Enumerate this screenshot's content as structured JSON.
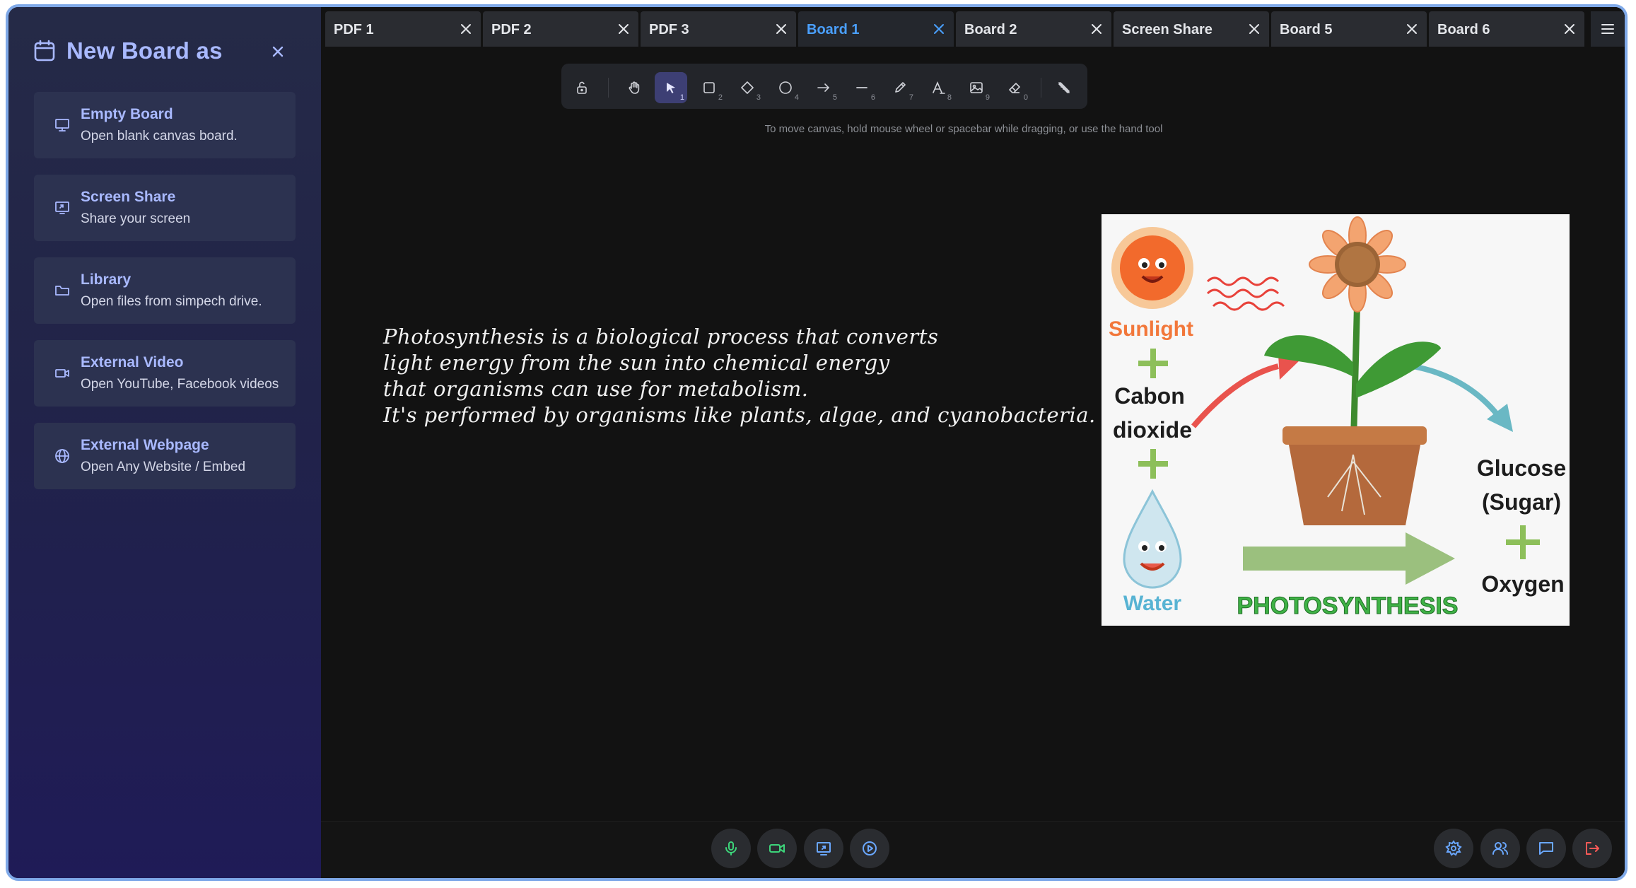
{
  "sidebar": {
    "title": "New Board as",
    "items": [
      {
        "title": "Empty Board",
        "subtitle": "Open blank canvas board.",
        "icon": "presentation-board-icon"
      },
      {
        "title": "Screen Share",
        "subtitle": "Share your screen",
        "icon": "screen-share-icon"
      },
      {
        "title": "Library",
        "subtitle": "Open files from simpech drive.",
        "icon": "folder-icon"
      },
      {
        "title": "External Video",
        "subtitle": "Open YouTube, Facebook videos",
        "icon": "video-camera-icon"
      },
      {
        "title": "External Webpage",
        "subtitle": "Open Any Website / Embed",
        "icon": "globe-icon"
      }
    ]
  },
  "tabs": [
    {
      "label": "PDF 1",
      "active": false
    },
    {
      "label": "PDF 2",
      "active": false
    },
    {
      "label": "PDF 3",
      "active": false
    },
    {
      "label": "Board 1",
      "active": true
    },
    {
      "label": "Board 2",
      "active": false
    },
    {
      "label": "Screen Share",
      "active": false
    },
    {
      "label": "Board 5",
      "active": false
    },
    {
      "label": "Board 6",
      "active": false
    }
  ],
  "toolbar": {
    "tools": [
      {
        "name": "lock-icon",
        "key": ""
      },
      {
        "name": "hand-icon",
        "key": ""
      },
      {
        "name": "select-arrow-icon",
        "key": "1",
        "selected": true
      },
      {
        "name": "rectangle-icon",
        "key": "2"
      },
      {
        "name": "diamond-icon",
        "key": "3"
      },
      {
        "name": "ellipse-icon",
        "key": "4"
      },
      {
        "name": "arrow-icon",
        "key": "5"
      },
      {
        "name": "line-icon",
        "key": "6"
      },
      {
        "name": "pencil-icon",
        "key": "7"
      },
      {
        "name": "text-icon",
        "key": "8"
      },
      {
        "name": "image-icon",
        "key": "9"
      },
      {
        "name": "eraser-icon",
        "key": "0"
      },
      {
        "name": "laser-pointer-icon",
        "key": ""
      }
    ],
    "hint": "To move canvas, hold mouse wheel or spacebar while dragging, or use the hand tool"
  },
  "canvas": {
    "text_lines": [
      "Photosynthesis is a biological process that converts",
      "light energy from the sun into chemical energy",
      "that organisms can use for metabolism.",
      "It's performed by organisms like plants, algae, and cyanobacteria."
    ],
    "illustration": {
      "labels": {
        "sunlight": "Sunlight",
        "co2_line1": "Cabon",
        "co2_line2": "dioxide",
        "water": "Water",
        "glucose_line1": "Glucose",
        "glucose_line2": "(Sugar)",
        "oxygen": "Oxygen",
        "process": "PHOTOSYNTHESIS"
      },
      "colors": {
        "sun": "#f26a2c",
        "label_orange": "#f2773a",
        "plus_green": "#8dbf5a",
        "arrow_green": "#9bc07e",
        "title_green": "#3fb246"
      }
    }
  },
  "bottombar": {
    "left_controls": [
      "microphone-icon",
      "camera-icon",
      "screen-share-icon",
      "record-icon"
    ],
    "right_controls": [
      "settings-icon",
      "participants-icon",
      "chat-icon",
      "leave-icon"
    ]
  }
}
